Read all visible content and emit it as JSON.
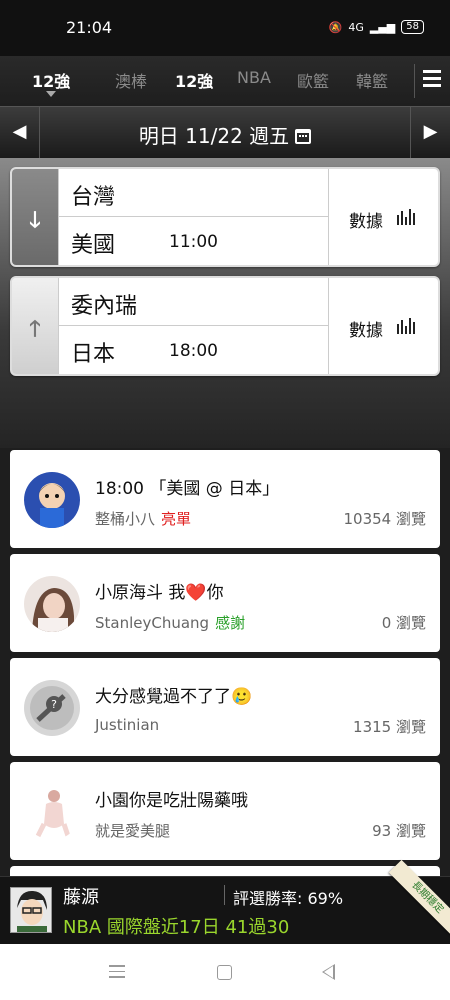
{
  "status_bar": {
    "time": "21:04",
    "network": "4G",
    "battery": "58"
  },
  "tabs": [
    {
      "label": "12強",
      "active": true
    },
    {
      "label": "澳棒",
      "active": false
    },
    {
      "label": "12強",
      "active": false
    },
    {
      "label": "NBA",
      "active": false
    },
    {
      "label": "歐籃",
      "active": false
    },
    {
      "label": "韓籃",
      "active": false
    }
  ],
  "date_bar": {
    "date": "明日 11/22 週五",
    "prev_glyph": "◀",
    "next_glyph": "▶"
  },
  "games": [
    {
      "team_top": "台灣",
      "team_bottom": "美國",
      "time": "11:00",
      "stats_label": "數據",
      "arrow": "down",
      "arrow_glyph": "🡓"
    },
    {
      "team_top": "委內瑞",
      "team_bottom": "日本",
      "time": "18:00",
      "stats_label": "數據",
      "arrow": "up",
      "arrow_glyph": "🡑"
    }
  ],
  "posts": [
    {
      "title": "18:00 「美國 @ 日本」",
      "author": "整桶小八",
      "tag": "亮單",
      "tag_color": "#e02020",
      "views": "10354 瀏覽"
    },
    {
      "title": "小原海斗 我❤️你",
      "author": "StanleyChuang",
      "tag": "感謝",
      "tag_color": "#2aa02a",
      "views": "0 瀏覽"
    },
    {
      "title": "大分感覺過不了了🥲",
      "author": "Justinian",
      "tag": "",
      "tag_color": "",
      "views": "1315 瀏覽"
    },
    {
      "title": "小園你是吃壯陽藥哦",
      "author": "就是愛美腿",
      "tag": "",
      "tag_color": "",
      "views": "93 瀏覽"
    }
  ],
  "banner": {
    "name": "藤源",
    "rate_label": "評選勝率: 69%",
    "record": "NBA 國際盤近17日 41過30",
    "ribbon": "長期穩定"
  }
}
